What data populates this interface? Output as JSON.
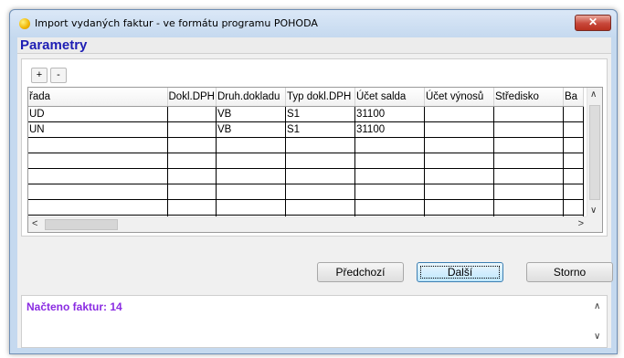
{
  "window": {
    "title": "Import vydaných faktur - ve formátu programu POHODA",
    "close_glyph": "✕"
  },
  "section": {
    "title": "Parametry"
  },
  "toolbar": {
    "add_label": "+",
    "remove_label": "-"
  },
  "table": {
    "columns": [
      "řada",
      "Dokl.DPH",
      "Druh.dokladu",
      "Typ dokl.DPH",
      "Účet salda",
      "Účet výnosů",
      "Středisko",
      "Ba"
    ],
    "rows": [
      [
        "UD",
        "",
        "VB",
        "S1",
        "31100",
        "",
        "",
        ""
      ],
      [
        "UN",
        "",
        "VB",
        "S1",
        "31100",
        "",
        "",
        ""
      ],
      [
        "",
        "",
        "",
        "",
        "",
        "",
        "",
        ""
      ],
      [
        "",
        "",
        "",
        "",
        "",
        "",
        "",
        ""
      ],
      [
        "",
        "",
        "",
        "",
        "",
        "",
        "",
        ""
      ],
      [
        "",
        "",
        "",
        "",
        "",
        "",
        "",
        ""
      ],
      [
        "",
        "",
        "",
        "",
        "",
        "",
        "",
        ""
      ],
      [
        "",
        "",
        "",
        "",
        "",
        "",
        "",
        ""
      ]
    ]
  },
  "buttons": {
    "prev_label": "Předchozí",
    "next_label": "Další",
    "cancel_label": "Storno"
  },
  "log": {
    "text": "Načteno faktur: 14"
  },
  "icons": {
    "app": "app-icon",
    "close": "close-icon",
    "scroll_up": "chevron-up-icon",
    "scroll_down": "chevron-down-icon",
    "scroll_left": "chevron-left-icon",
    "scroll_right": "chevron-right-icon"
  },
  "colors": {
    "section_title": "#1e1eb4",
    "log_text": "#8a2be2",
    "close_button": "#c8473a"
  }
}
